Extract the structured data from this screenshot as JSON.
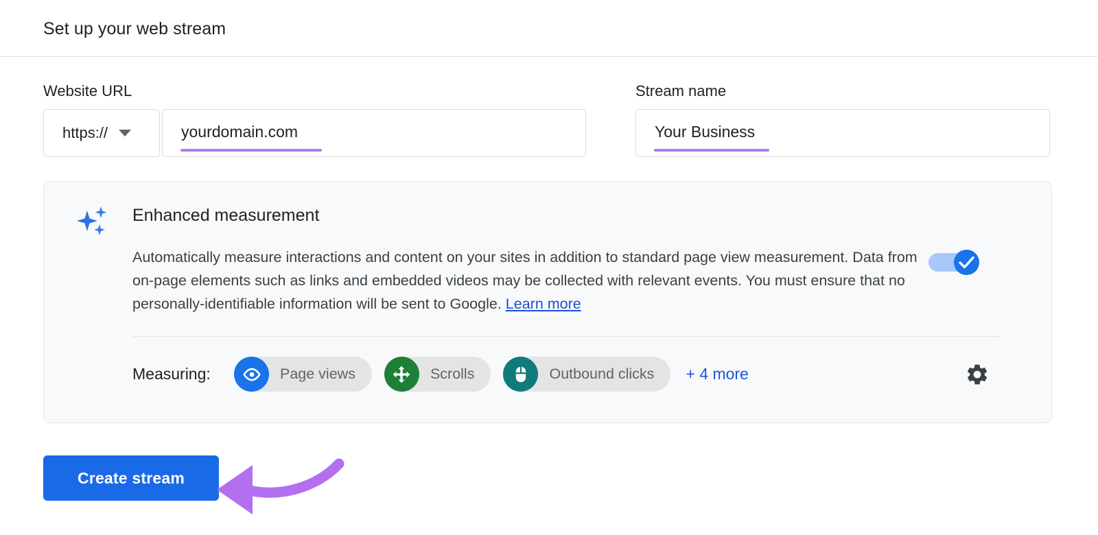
{
  "header": {
    "title": "Set up your web stream"
  },
  "form": {
    "url_label": "Website URL",
    "protocol_value": "https://",
    "url_value": "yourdomain.com",
    "name_label": "Stream name",
    "name_value": "Your Business"
  },
  "enhanced_measurement": {
    "icon": "sparkle-icon",
    "title": "Enhanced measurement",
    "body": "Automatically measure interactions and content on your sites in addition to standard page view measurement. Data from on-page elements such as links and embedded videos may be collected with relevant events. You must ensure that no personally-identifiable information will be sent to Google.",
    "learn_more": "Learn more",
    "toggle_state": "on",
    "measuring_label": "Measuring:",
    "chips": [
      {
        "label": "Page views",
        "icon": "eye-icon",
        "color": "#1a73e8"
      },
      {
        "label": "Scrolls",
        "icon": "move-arrows-icon",
        "color": "#1e8037"
      },
      {
        "label": "Outbound clicks",
        "icon": "mouse-icon",
        "color": "#0f7b7b"
      }
    ],
    "more_label": "+ 4 more",
    "settings_icon": "gear-icon"
  },
  "actions": {
    "create_label": "Create stream"
  },
  "annotation": {
    "arrow_color": "#b46ff0"
  },
  "colors": {
    "accent_blue": "#1a6ae8",
    "link_blue": "#1a56db",
    "underline_purple": "#ab7df8",
    "panel_bg": "#f8f9fa"
  }
}
